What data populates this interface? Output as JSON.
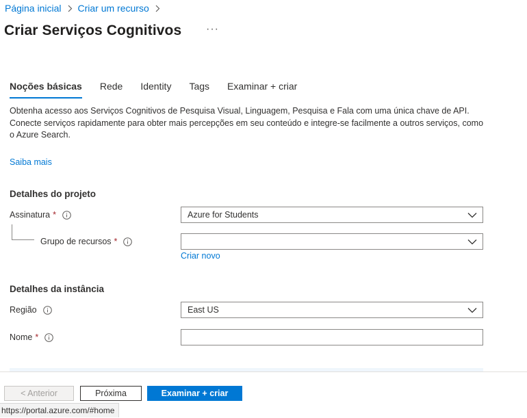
{
  "breadcrumb": {
    "items": [
      "Página inicial",
      "Criar um recurso"
    ]
  },
  "page": {
    "title": "Criar Serviços Cognitivos",
    "more_label": "···"
  },
  "tabs": [
    {
      "label": "Noções básicas",
      "active": true
    },
    {
      "label": "Rede",
      "active": false
    },
    {
      "label": "Identity",
      "active": false
    },
    {
      "label": "Tags",
      "active": false
    },
    {
      "label": "Examinar + criar",
      "active": false
    }
  ],
  "description": {
    "text": "Obtenha acesso aos Serviços Cognitivos de Pesquisa Visual, Linguagem, Pesquisa e Fala com uma única chave de API. Conecte serviços rapidamente para obter mais percepções em seu conteúdo e integre-se facilmente a outros serviços, como o Azure Search.",
    "learn_more": "Saiba mais"
  },
  "project_details": {
    "heading": "Detalhes do projeto",
    "subscription": {
      "label": "Assinatura",
      "required": "*",
      "value": "Azure for Students"
    },
    "resource_group": {
      "label": "Grupo de recursos",
      "required": "*",
      "value": "",
      "create_new": "Criar novo"
    }
  },
  "instance_details": {
    "heading": "Detalhes da instância",
    "region": {
      "label": "Região",
      "value": "East US"
    },
    "name": {
      "label": "Nome",
      "required": "*",
      "value": ""
    }
  },
  "footer": {
    "previous_label": "< Anterior",
    "next_label": "Próxima",
    "review_label": "Examinar + criar"
  },
  "status_bar": {
    "url": "https://portal.azure.com/#home"
  },
  "colors": {
    "accent": "#0078d4",
    "required": "#a4262c",
    "text": "#323130"
  },
  "icons": [
    "chevron-right-icon",
    "info-icon",
    "chevron-down-icon"
  ]
}
